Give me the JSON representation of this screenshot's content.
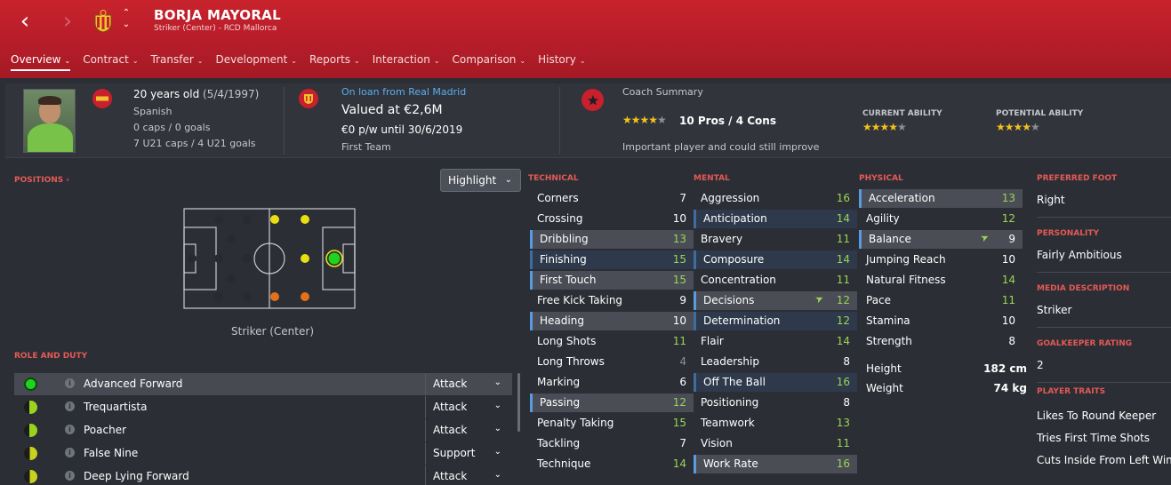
{
  "header": {
    "player_name": "BORJA MAYORAL",
    "subtitle": "Striker (Center) - RCD Mallorca",
    "back_icon": "chevron-left-icon",
    "forward_icon": "chevron-right-icon",
    "crest_icon": "club-crest-icon",
    "tabs": [
      {
        "label": "Overview"
      },
      {
        "label": "Contract"
      },
      {
        "label": "Transfer"
      },
      {
        "label": "Development"
      },
      {
        "label": "Reports"
      },
      {
        "label": "Interaction"
      },
      {
        "label": "Comparison"
      },
      {
        "label": "History"
      }
    ],
    "accent": "#c8232d"
  },
  "summary": {
    "age": "20 years old",
    "dob": "(5/4/1997)",
    "nationality": "Spanish",
    "caps": "0 caps / 0 goals",
    "u21": "7 U21 caps / 4 U21 goals",
    "loan": "On loan from Real Madrid",
    "value": "Valued at €2,6M",
    "wage": "€0 p/w until 30/6/2019",
    "squad": "First Team",
    "coach_title": "Coach Summary",
    "pros_cons": "10 Pros / 4 Cons",
    "coach_note": "Important player and could still improve",
    "current_ability_label": "CURRENT ABILITY",
    "potential_ability_label": "POTENTIAL ABILITY",
    "coach_stars": 4.5,
    "current_stars": 4.5,
    "potential_stars": 4.5
  },
  "positions": {
    "title": "POSITIONS",
    "highlight_label": "Highlight",
    "caption": "Striker (Center)"
  },
  "roles": {
    "title": "ROLE AND DUTY",
    "items": [
      {
        "name": "Advanced Forward",
        "duty": "Attack",
        "color": "#1ed41e"
      },
      {
        "name": "Trequartista",
        "duty": "Attack",
        "color": "#9bd31c"
      },
      {
        "name": "Poacher",
        "duty": "Attack",
        "color": "#9bd31c"
      },
      {
        "name": "False Nine",
        "duty": "Support",
        "color": "#c9d21c"
      },
      {
        "name": "Deep Lying Forward",
        "duty": "Attack",
        "color": "#c9d21c"
      }
    ]
  },
  "technical": {
    "title": "TECHNICAL",
    "items": [
      {
        "name": "Corners",
        "value": "7",
        "hl": ""
      },
      {
        "name": "Crossing",
        "value": "10",
        "hl": ""
      },
      {
        "name": "Dribbling",
        "value": "13",
        "hl": "hl"
      },
      {
        "name": "Finishing",
        "value": "15",
        "hl": "hl2"
      },
      {
        "name": "First Touch",
        "value": "15",
        "hl": "hl"
      },
      {
        "name": "Free Kick Taking",
        "value": "9",
        "hl": ""
      },
      {
        "name": "Heading",
        "value": "10",
        "hl": "hl"
      },
      {
        "name": "Long Shots",
        "value": "11",
        "hl": ""
      },
      {
        "name": "Long Throws",
        "value": "4",
        "hl": ""
      },
      {
        "name": "Marking",
        "value": "6",
        "hl": ""
      },
      {
        "name": "Passing",
        "value": "12",
        "hl": "hl"
      },
      {
        "name": "Penalty Taking",
        "value": "15",
        "hl": ""
      },
      {
        "name": "Tackling",
        "value": "7",
        "hl": ""
      },
      {
        "name": "Technique",
        "value": "14",
        "hl": ""
      }
    ]
  },
  "mental": {
    "title": "MENTAL",
    "items": [
      {
        "name": "Aggression",
        "value": "16",
        "hl": ""
      },
      {
        "name": "Anticipation",
        "value": "14",
        "hl": "hl2"
      },
      {
        "name": "Bravery",
        "value": "11",
        "hl": ""
      },
      {
        "name": "Composure",
        "value": "14",
        "hl": "hl2"
      },
      {
        "name": "Concentration",
        "value": "11",
        "hl": ""
      },
      {
        "name": "Decisions",
        "value": "12",
        "hl": "hl",
        "arrow": true
      },
      {
        "name": "Determination",
        "value": "12",
        "hl": "hl2"
      },
      {
        "name": "Flair",
        "value": "14",
        "hl": ""
      },
      {
        "name": "Leadership",
        "value": "8",
        "hl": ""
      },
      {
        "name": "Off The Ball",
        "value": "16",
        "hl": "hl2"
      },
      {
        "name": "Positioning",
        "value": "8",
        "hl": ""
      },
      {
        "name": "Teamwork",
        "value": "13",
        "hl": ""
      },
      {
        "name": "Vision",
        "value": "11",
        "hl": ""
      },
      {
        "name": "Work Rate",
        "value": "16",
        "hl": "hl"
      }
    ]
  },
  "physical": {
    "title": "PHYSICAL",
    "items": [
      {
        "name": "Acceleration",
        "value": "13",
        "hl": "hl"
      },
      {
        "name": "Agility",
        "value": "12",
        "hl": ""
      },
      {
        "name": "Balance",
        "value": "9",
        "hl": "hl",
        "arrow": true
      },
      {
        "name": "Jumping Reach",
        "value": "10",
        "hl": ""
      },
      {
        "name": "Natural Fitness",
        "value": "14",
        "hl": ""
      },
      {
        "name": "Pace",
        "value": "11",
        "hl": ""
      },
      {
        "name": "Stamina",
        "value": "10",
        "hl": ""
      },
      {
        "name": "Strength",
        "value": "8",
        "hl": ""
      }
    ],
    "height_label": "Height",
    "height": "182 cm",
    "weight_label": "Weight",
    "weight": "74 kg"
  },
  "info": {
    "preferred_foot_title": "PREFERRED FOOT",
    "preferred_foot": "Right",
    "personality_title": "PERSONALITY",
    "personality": "Fairly Ambitious",
    "media_title": "MEDIA DESCRIPTION",
    "media": "Striker",
    "gk_title": "GOALKEEPER RATING",
    "gk": "2",
    "traits_title": "PLAYER TRAITS",
    "traits": [
      "Likes To Round Keeper",
      "Tries First Time Shots",
      "Cuts Inside From Left Wing"
    ]
  }
}
